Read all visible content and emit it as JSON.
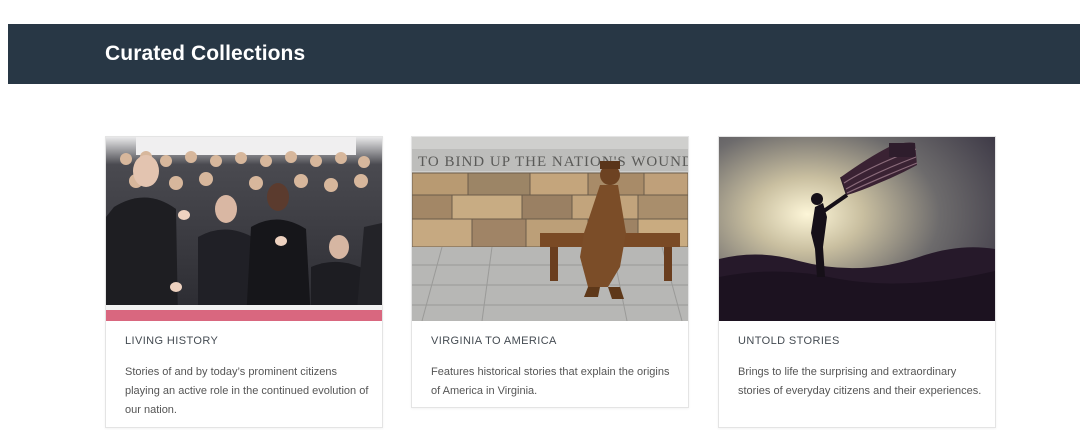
{
  "header": {
    "title": "Curated Collections"
  },
  "collections": [
    {
      "title": "LIVING HISTORY",
      "description": "Stories of and by today’s prominent citizens playing an active role in the continued evolution of our nation.",
      "image": "crowd-applauding-photo"
    },
    {
      "title": "VIRGINIA TO AMERICA",
      "description": "Features historical stories that explain the origins of America in Virginia.",
      "image": "statue-on-bench-photo",
      "image_inscription": "TO BIND UP THE NATION'S WOUNDS"
    },
    {
      "title": "UNTOLD STORIES",
      "description": "Brings to life the surprising and extraordinary stories of everyday citizens and their experiences.",
      "image": "flag-silhouette-photo"
    }
  ],
  "colors": {
    "header_bg": "#283745",
    "card_border": "#e4e4e4",
    "accent_pink": "#d9677f"
  }
}
